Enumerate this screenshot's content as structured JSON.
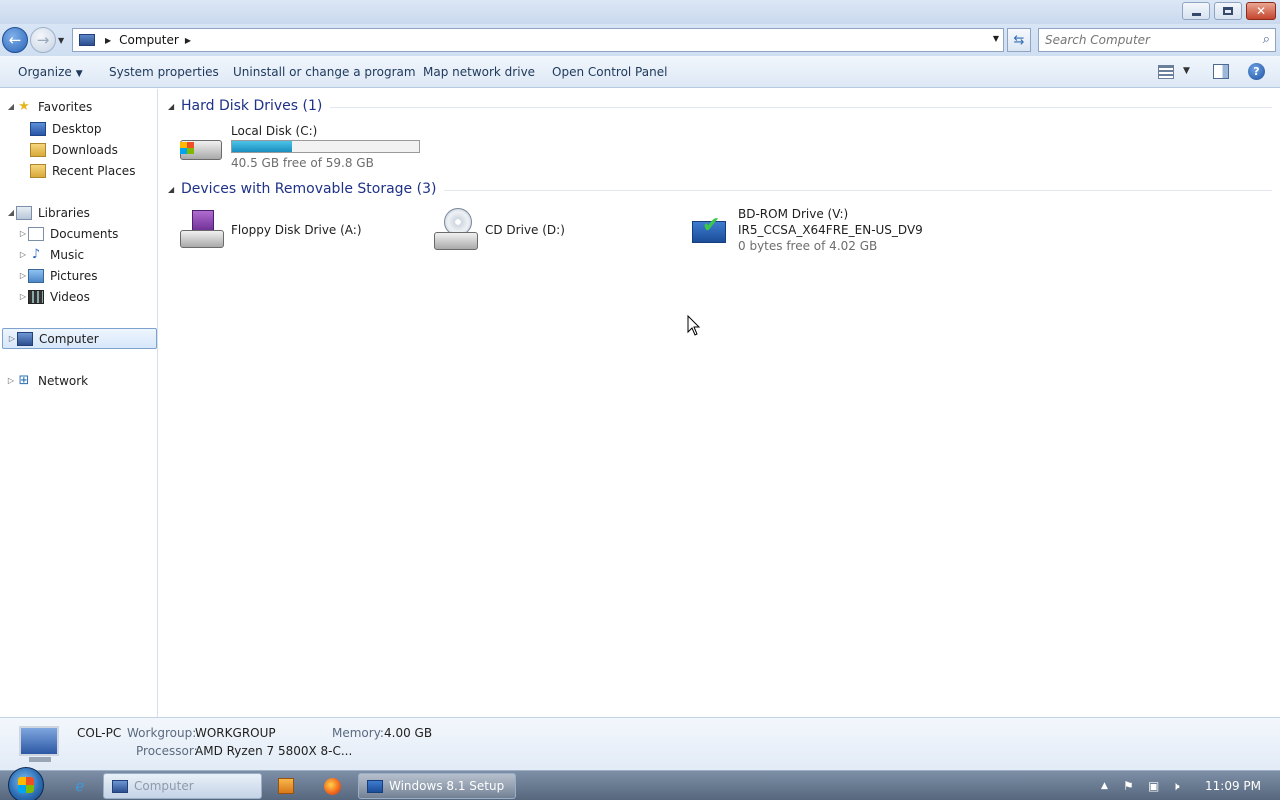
{
  "address": {
    "crumb": "Computer"
  },
  "search": {
    "placeholder": "Search Computer"
  },
  "commands": {
    "organize": "Organize",
    "system_properties": "System properties",
    "uninstall": "Uninstall or change a program",
    "map_network": "Map network drive",
    "control_panel": "Open Control Panel"
  },
  "nav": {
    "favorites": "Favorites",
    "desktop": "Desktop",
    "downloads": "Downloads",
    "recent_places": "Recent Places",
    "libraries": "Libraries",
    "documents": "Documents",
    "music": "Music",
    "pictures": "Pictures",
    "videos": "Videos",
    "computer": "Computer",
    "network": "Network"
  },
  "groups": {
    "hard_disks": "Hard Disk Drives (1)",
    "removable": "Devices with Removable Storage (3)"
  },
  "drives": {
    "local_c": {
      "name": "Local Disk (C:)",
      "free": "40.5 GB free of 59.8 GB",
      "used_fraction": 0.32
    },
    "floppy": {
      "name": "Floppy Disk Drive (A:)"
    },
    "cd": {
      "name": "CD Drive (D:)"
    },
    "bd": {
      "name": "BD-ROM Drive (V:)",
      "label": "IR5_CCSA_X64FRE_EN-US_DV9",
      "free": "0 bytes free of 4.02 GB"
    }
  },
  "details": {
    "pc_name": "COL-PC",
    "workgroup_label": "Workgroup:",
    "workgroup_value": "WORKGROUP",
    "memory_label": "Memory:",
    "memory_value": "4.00 GB",
    "processor_label": "Processor:",
    "processor_value": "AMD Ryzen 7 5800X 8-C..."
  },
  "taskbar": {
    "explorer_task": "Computer",
    "setup_task": "Windows 8.1 Setup",
    "clock": "11:09 PM"
  },
  "colors": {
    "group_title": "#1e3287",
    "bar_fill": "#1a8fbf"
  }
}
